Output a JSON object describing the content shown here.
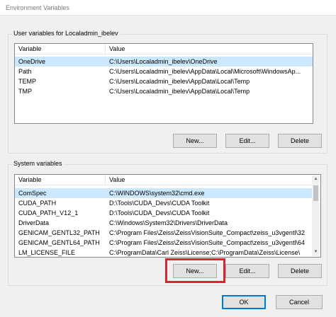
{
  "window": {
    "title": "Environment Variables"
  },
  "user_vars": {
    "group_label": "User variables for Localadmin_ibelev",
    "columns": [
      "Variable",
      "Value"
    ],
    "rows": [
      {
        "variable": "OneDrive",
        "value": "C:\\Users\\Localadmin_ibelev\\OneDrive",
        "selected": true
      },
      {
        "variable": "Path",
        "value": "C:\\Users\\Localadmin_ibelev\\AppData\\Local\\Microsoft\\WindowsAp..."
      },
      {
        "variable": "TEMP",
        "value": "C:\\Users\\Localadmin_ibelev\\AppData\\Local\\Temp"
      },
      {
        "variable": "TMP",
        "value": "C:\\Users\\Localadmin_ibelev\\AppData\\Local\\Temp"
      }
    ],
    "buttons": {
      "new": "New...",
      "edit": "Edit...",
      "delete": "Delete"
    }
  },
  "system_vars": {
    "group_label": "System variables",
    "columns": [
      "Variable",
      "Value"
    ],
    "rows": [
      {
        "variable": "ComSpec",
        "value": "C:\\WINDOWS\\system32\\cmd.exe",
        "selected": true
      },
      {
        "variable": "CUDA_PATH",
        "value": "D:\\Tools\\CUDA_Devs\\CUDA Toolkit"
      },
      {
        "variable": "CUDA_PATH_V12_1",
        "value": "D:\\Tools\\CUDA_Devs\\CUDA Toolkit"
      },
      {
        "variable": "DriverData",
        "value": "C:\\Windows\\System32\\Drivers\\DriverData"
      },
      {
        "variable": "GENICAM_GENTL32_PATH",
        "value": "C:\\Program Files\\Zeiss\\ZeissVisionSuite_Compact\\zeiss_u3vgentl\\32"
      },
      {
        "variable": "GENICAM_GENTL64_PATH",
        "value": "C:\\Program Files\\Zeiss\\ZeissVisionSuite_Compact\\zeiss_u3vgentl\\64"
      },
      {
        "variable": "LM_LICENSE_FILE",
        "value": "C:\\ProgramData\\Carl Zeiss\\License;C:\\ProgramData\\Zeiss\\License\\"
      }
    ],
    "buttons": {
      "new": "New...",
      "edit": "Edit...",
      "delete": "Delete"
    }
  },
  "dialog_buttons": {
    "ok": "OK",
    "cancel": "Cancel"
  },
  "colors": {
    "highlight": "#d9262b",
    "selection": "#cce8ff",
    "accent": "#0078d7"
  }
}
